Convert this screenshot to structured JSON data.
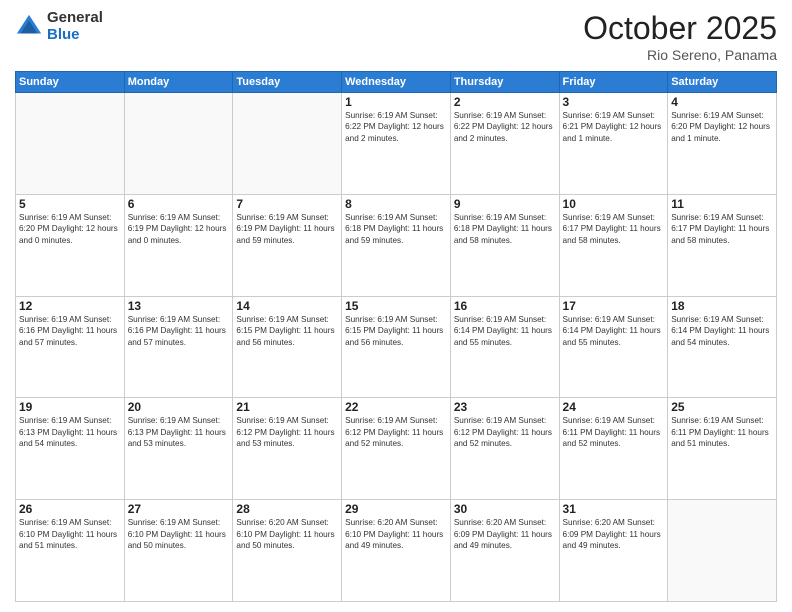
{
  "header": {
    "logo_general": "General",
    "logo_blue": "Blue",
    "title": "October 2025",
    "location": "Rio Sereno, Panama"
  },
  "weekdays": [
    "Sunday",
    "Monday",
    "Tuesday",
    "Wednesday",
    "Thursday",
    "Friday",
    "Saturday"
  ],
  "weeks": [
    [
      {
        "day": "",
        "info": ""
      },
      {
        "day": "",
        "info": ""
      },
      {
        "day": "",
        "info": ""
      },
      {
        "day": "1",
        "info": "Sunrise: 6:19 AM\nSunset: 6:22 PM\nDaylight: 12 hours and 2 minutes."
      },
      {
        "day": "2",
        "info": "Sunrise: 6:19 AM\nSunset: 6:22 PM\nDaylight: 12 hours and 2 minutes."
      },
      {
        "day": "3",
        "info": "Sunrise: 6:19 AM\nSunset: 6:21 PM\nDaylight: 12 hours and 1 minute."
      },
      {
        "day": "4",
        "info": "Sunrise: 6:19 AM\nSunset: 6:20 PM\nDaylight: 12 hours and 1 minute."
      }
    ],
    [
      {
        "day": "5",
        "info": "Sunrise: 6:19 AM\nSunset: 6:20 PM\nDaylight: 12 hours and 0 minutes."
      },
      {
        "day": "6",
        "info": "Sunrise: 6:19 AM\nSunset: 6:19 PM\nDaylight: 12 hours and 0 minutes."
      },
      {
        "day": "7",
        "info": "Sunrise: 6:19 AM\nSunset: 6:19 PM\nDaylight: 11 hours and 59 minutes."
      },
      {
        "day": "8",
        "info": "Sunrise: 6:19 AM\nSunset: 6:18 PM\nDaylight: 11 hours and 59 minutes."
      },
      {
        "day": "9",
        "info": "Sunrise: 6:19 AM\nSunset: 6:18 PM\nDaylight: 11 hours and 58 minutes."
      },
      {
        "day": "10",
        "info": "Sunrise: 6:19 AM\nSunset: 6:17 PM\nDaylight: 11 hours and 58 minutes."
      },
      {
        "day": "11",
        "info": "Sunrise: 6:19 AM\nSunset: 6:17 PM\nDaylight: 11 hours and 58 minutes."
      }
    ],
    [
      {
        "day": "12",
        "info": "Sunrise: 6:19 AM\nSunset: 6:16 PM\nDaylight: 11 hours and 57 minutes."
      },
      {
        "day": "13",
        "info": "Sunrise: 6:19 AM\nSunset: 6:16 PM\nDaylight: 11 hours and 57 minutes."
      },
      {
        "day": "14",
        "info": "Sunrise: 6:19 AM\nSunset: 6:15 PM\nDaylight: 11 hours and 56 minutes."
      },
      {
        "day": "15",
        "info": "Sunrise: 6:19 AM\nSunset: 6:15 PM\nDaylight: 11 hours and 56 minutes."
      },
      {
        "day": "16",
        "info": "Sunrise: 6:19 AM\nSunset: 6:14 PM\nDaylight: 11 hours and 55 minutes."
      },
      {
        "day": "17",
        "info": "Sunrise: 6:19 AM\nSunset: 6:14 PM\nDaylight: 11 hours and 55 minutes."
      },
      {
        "day": "18",
        "info": "Sunrise: 6:19 AM\nSunset: 6:14 PM\nDaylight: 11 hours and 54 minutes."
      }
    ],
    [
      {
        "day": "19",
        "info": "Sunrise: 6:19 AM\nSunset: 6:13 PM\nDaylight: 11 hours and 54 minutes."
      },
      {
        "day": "20",
        "info": "Sunrise: 6:19 AM\nSunset: 6:13 PM\nDaylight: 11 hours and 53 minutes."
      },
      {
        "day": "21",
        "info": "Sunrise: 6:19 AM\nSunset: 6:12 PM\nDaylight: 11 hours and 53 minutes."
      },
      {
        "day": "22",
        "info": "Sunrise: 6:19 AM\nSunset: 6:12 PM\nDaylight: 11 hours and 52 minutes."
      },
      {
        "day": "23",
        "info": "Sunrise: 6:19 AM\nSunset: 6:12 PM\nDaylight: 11 hours and 52 minutes."
      },
      {
        "day": "24",
        "info": "Sunrise: 6:19 AM\nSunset: 6:11 PM\nDaylight: 11 hours and 52 minutes."
      },
      {
        "day": "25",
        "info": "Sunrise: 6:19 AM\nSunset: 6:11 PM\nDaylight: 11 hours and 51 minutes."
      }
    ],
    [
      {
        "day": "26",
        "info": "Sunrise: 6:19 AM\nSunset: 6:10 PM\nDaylight: 11 hours and 51 minutes."
      },
      {
        "day": "27",
        "info": "Sunrise: 6:19 AM\nSunset: 6:10 PM\nDaylight: 11 hours and 50 minutes."
      },
      {
        "day": "28",
        "info": "Sunrise: 6:20 AM\nSunset: 6:10 PM\nDaylight: 11 hours and 50 minutes."
      },
      {
        "day": "29",
        "info": "Sunrise: 6:20 AM\nSunset: 6:10 PM\nDaylight: 11 hours and 49 minutes."
      },
      {
        "day": "30",
        "info": "Sunrise: 6:20 AM\nSunset: 6:09 PM\nDaylight: 11 hours and 49 minutes."
      },
      {
        "day": "31",
        "info": "Sunrise: 6:20 AM\nSunset: 6:09 PM\nDaylight: 11 hours and 49 minutes."
      },
      {
        "day": "",
        "info": ""
      }
    ]
  ]
}
